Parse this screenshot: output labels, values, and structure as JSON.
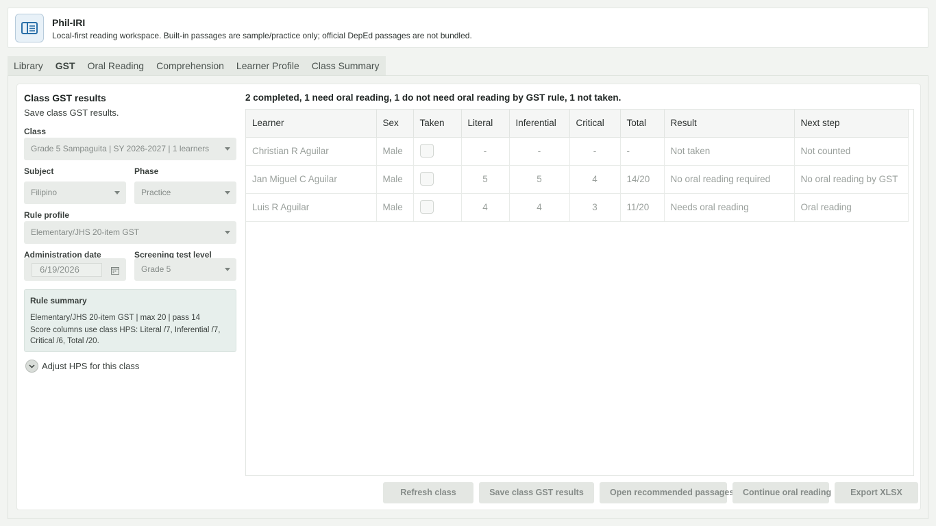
{
  "app": {
    "title": "Phil-IRI",
    "subtitle": "Local-first reading workspace. Built-in passages are sample/practice only; official DepEd passages are not bundled.",
    "logo_icon": "book-reader-icon"
  },
  "tabs": [
    {
      "label": "Library",
      "active": false
    },
    {
      "label": "GST",
      "active": true
    },
    {
      "label": "Oral Reading",
      "active": false
    },
    {
      "label": "Comprehension",
      "active": false
    },
    {
      "label": "Learner Profile",
      "active": false
    },
    {
      "label": "Class Summary",
      "active": false
    }
  ],
  "form": {
    "title": "Class GST results",
    "description": "Save class GST results.",
    "class_label": "Class",
    "class_value": "Grade 5 Sampaguita | SY 2026-2027 | 1 learners",
    "subject_label": "Subject",
    "subject_value": "Filipino",
    "phase_label": "Phase",
    "phase_value": "Practice",
    "rule_profile_label": "Rule profile",
    "rule_profile_value": "Elementary/JHS 20-item GST",
    "admin_date_label": "Administration date",
    "admin_date_value": "6/19/2026",
    "screening_label": "Screening test level",
    "screening_value": "Grade 5",
    "rule_summary_title": "Rule summary",
    "rule_summary_line1": "Elementary/JHS 20-item GST | max 20 | pass 14",
    "rule_summary_line2": "Score columns use class HPS: Literal /7, Inferential /7, Critical /6, Total /20.",
    "adjust_label": "Adjust HPS for this class"
  },
  "results": {
    "summary": "2 completed, 1 need oral reading, 1 do not need oral reading by GST rule, 1 not taken.",
    "columns": [
      "Learner",
      "Sex",
      "Taken",
      "Literal",
      "Inferential",
      "Critical",
      "Total",
      "Result",
      "Next step"
    ],
    "rows": [
      {
        "learner": "Christian R Aguilar",
        "sex": "Male",
        "taken": false,
        "literal": "-",
        "inferential": "-",
        "critical": "-",
        "total": "-",
        "result": "Not taken",
        "next": "Not counted"
      },
      {
        "learner": "Jan Miguel C Aguilar",
        "sex": "Male",
        "taken": false,
        "literal": "5",
        "inferential": "5",
        "critical": "4",
        "total": "14/20",
        "result": "No oral reading required",
        "next": "No oral reading by GST"
      },
      {
        "learner": "Luis R Aguilar",
        "sex": "Male",
        "taken": false,
        "literal": "4",
        "inferential": "4",
        "critical": "3",
        "total": "11/20",
        "result": "Needs oral reading",
        "next": "Oral reading"
      }
    ]
  },
  "actions": {
    "refresh": "Refresh class",
    "save": "Save class GST results",
    "open_passages": "Open recommended passages",
    "continue_oral": "Continue oral reading",
    "export": "Export XLSX"
  }
}
